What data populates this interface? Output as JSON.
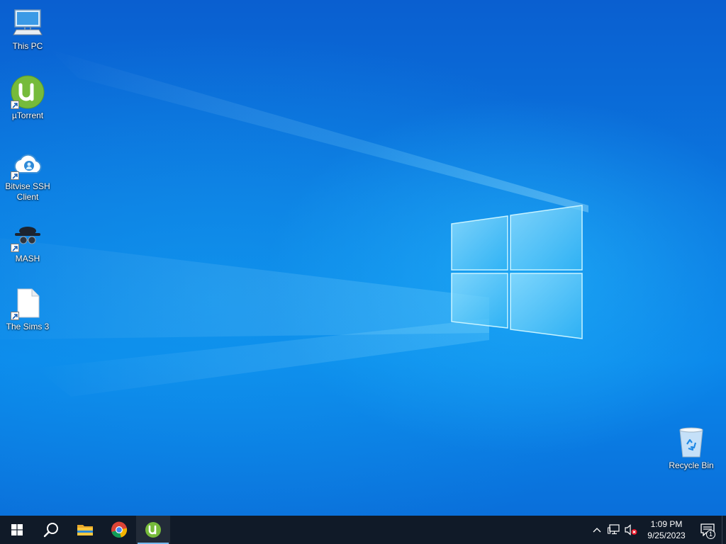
{
  "desktop": {
    "icons": [
      {
        "label": "This PC",
        "icon": "this-pc-icon"
      },
      {
        "label": "µTorrent",
        "icon": "utorrent-icon"
      },
      {
        "label": "Bitvise SSH Client",
        "icon": "bitvise-icon"
      },
      {
        "label": "MASH",
        "icon": "mash-icon"
      },
      {
        "label": "The Sims 3",
        "icon": "file-icon"
      },
      {
        "label": "Recycle Bin",
        "icon": "recycle-bin-icon"
      }
    ]
  },
  "taskbar": {
    "apps": [
      {
        "name": "Start",
        "icon": "windows-start-icon"
      },
      {
        "name": "Search",
        "icon": "search-icon"
      },
      {
        "name": "File Explorer",
        "icon": "folder-icon"
      },
      {
        "name": "Google Chrome",
        "icon": "chrome-icon"
      },
      {
        "name": "µTorrent",
        "icon": "utorrent-icon",
        "active": true
      }
    ],
    "tray": {
      "time": "1:09 PM",
      "date": "9/25/2023",
      "notification_count": "1"
    }
  },
  "colors": {
    "taskbar_bg": "#101a28",
    "accent": "#76b9ed",
    "desktop_blue": "#0a78e0"
  }
}
